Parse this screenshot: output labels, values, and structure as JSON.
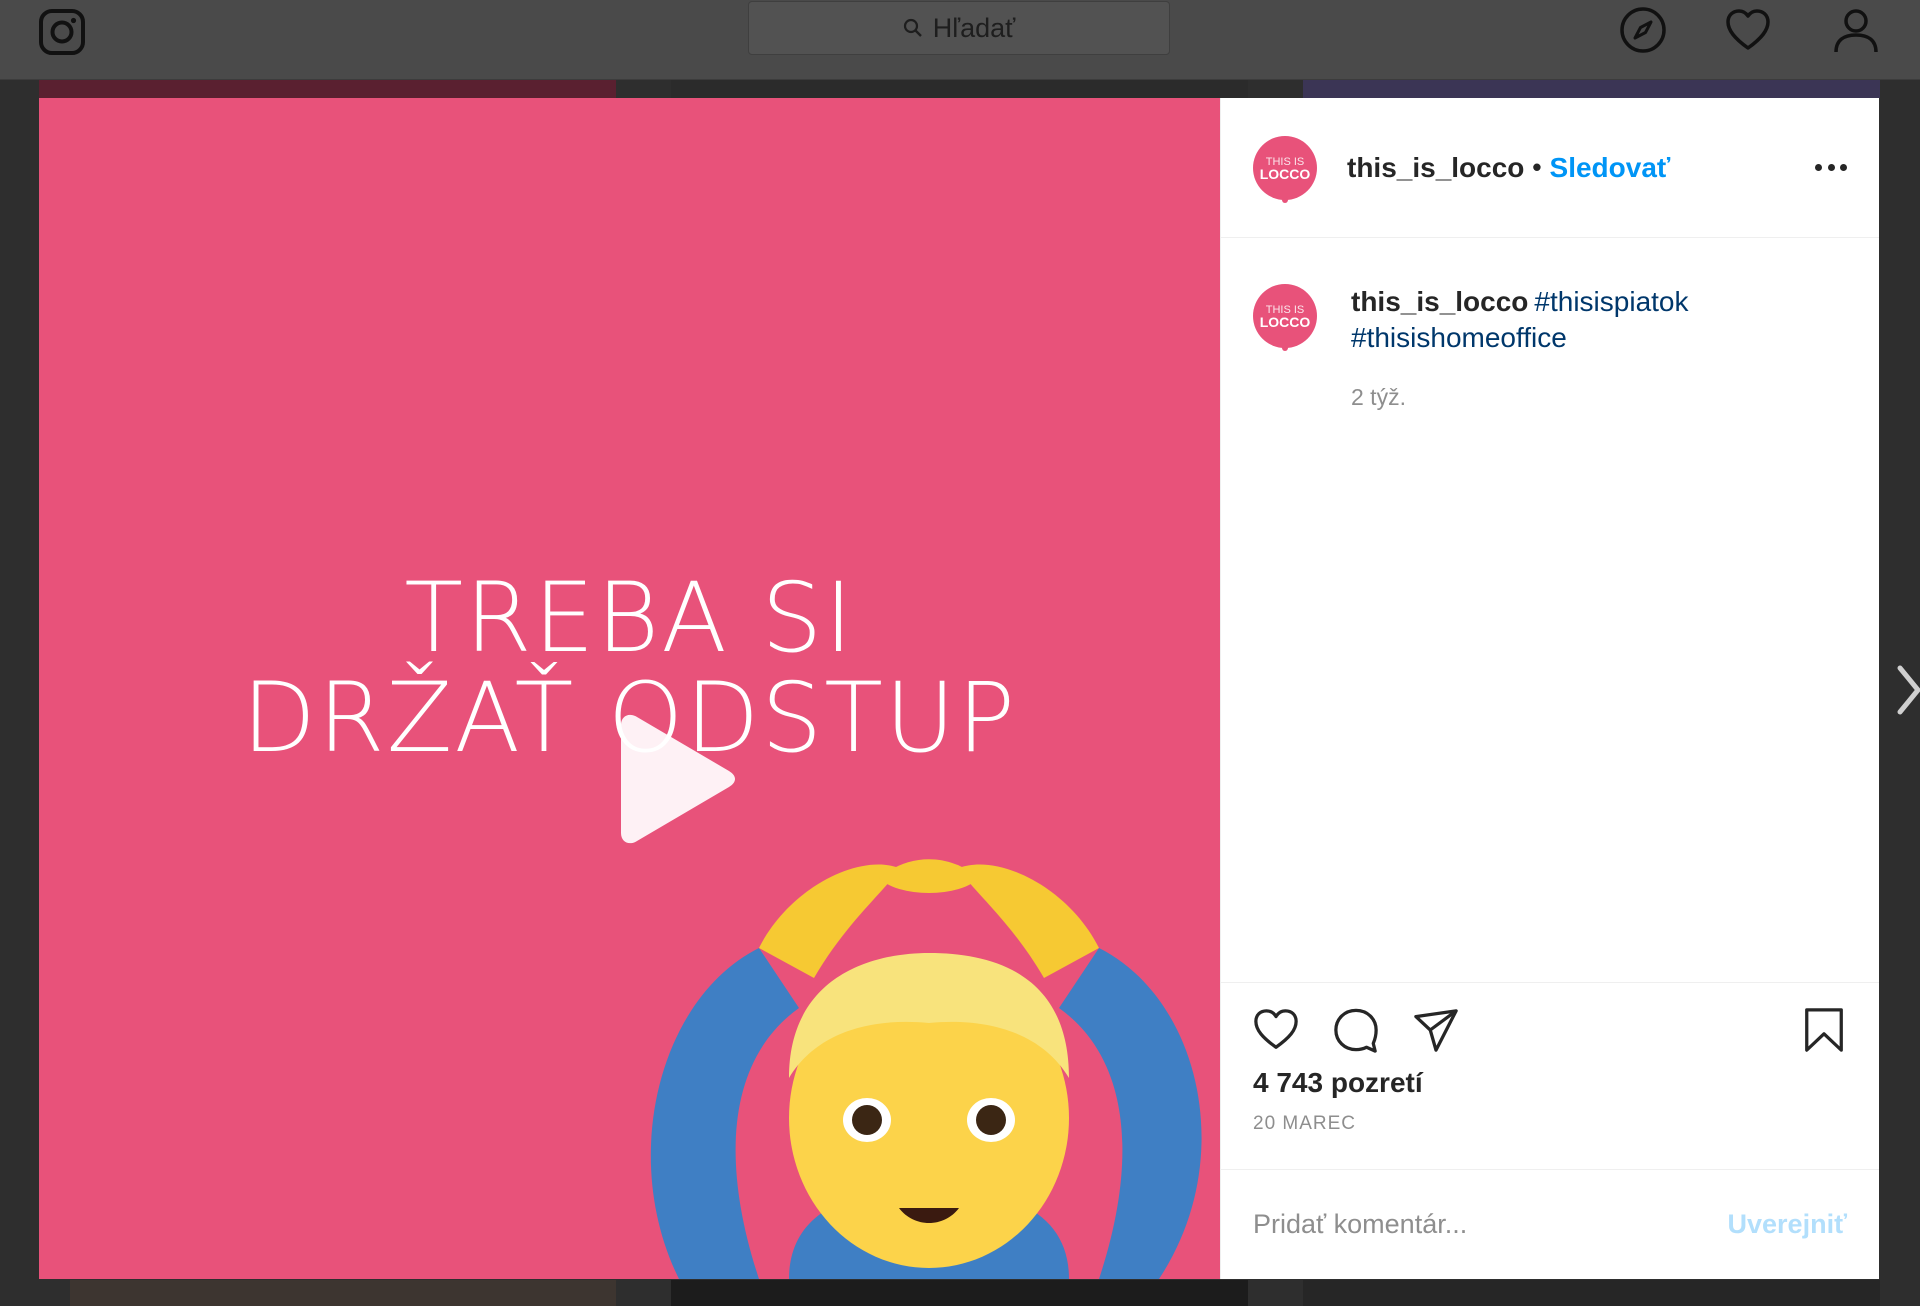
{
  "topbar": {
    "search_placeholder": "Hľadať",
    "icons": [
      "instagram-logo-icon",
      "search-icon",
      "compass-icon",
      "heart-icon",
      "profile-icon"
    ]
  },
  "post": {
    "video_text_line1": "TREBA SI",
    "video_text_line2": "DRŽAŤ ODSTUP",
    "header": {
      "avatar_line1": "THIS IS",
      "avatar_line2": "LOCCO",
      "username": "this_is_locco",
      "separator": "•",
      "follow_label": "Sledovať"
    },
    "caption": {
      "username": "this_is_locco",
      "hashtag1": "#thisispiatok",
      "hashtag2": "#thisishomeoffice",
      "time_ago": "2 týž."
    },
    "views": "4 743 pozretí",
    "date": "20 MAREC",
    "comment": {
      "placeholder": "Pridať komentár...",
      "post_label": "Uverejniť"
    }
  },
  "colors": {
    "video_background": "#e8527a",
    "accent": "#0095f6",
    "hashtag": "#00376b",
    "post_disabled": "#b2dffc"
  }
}
